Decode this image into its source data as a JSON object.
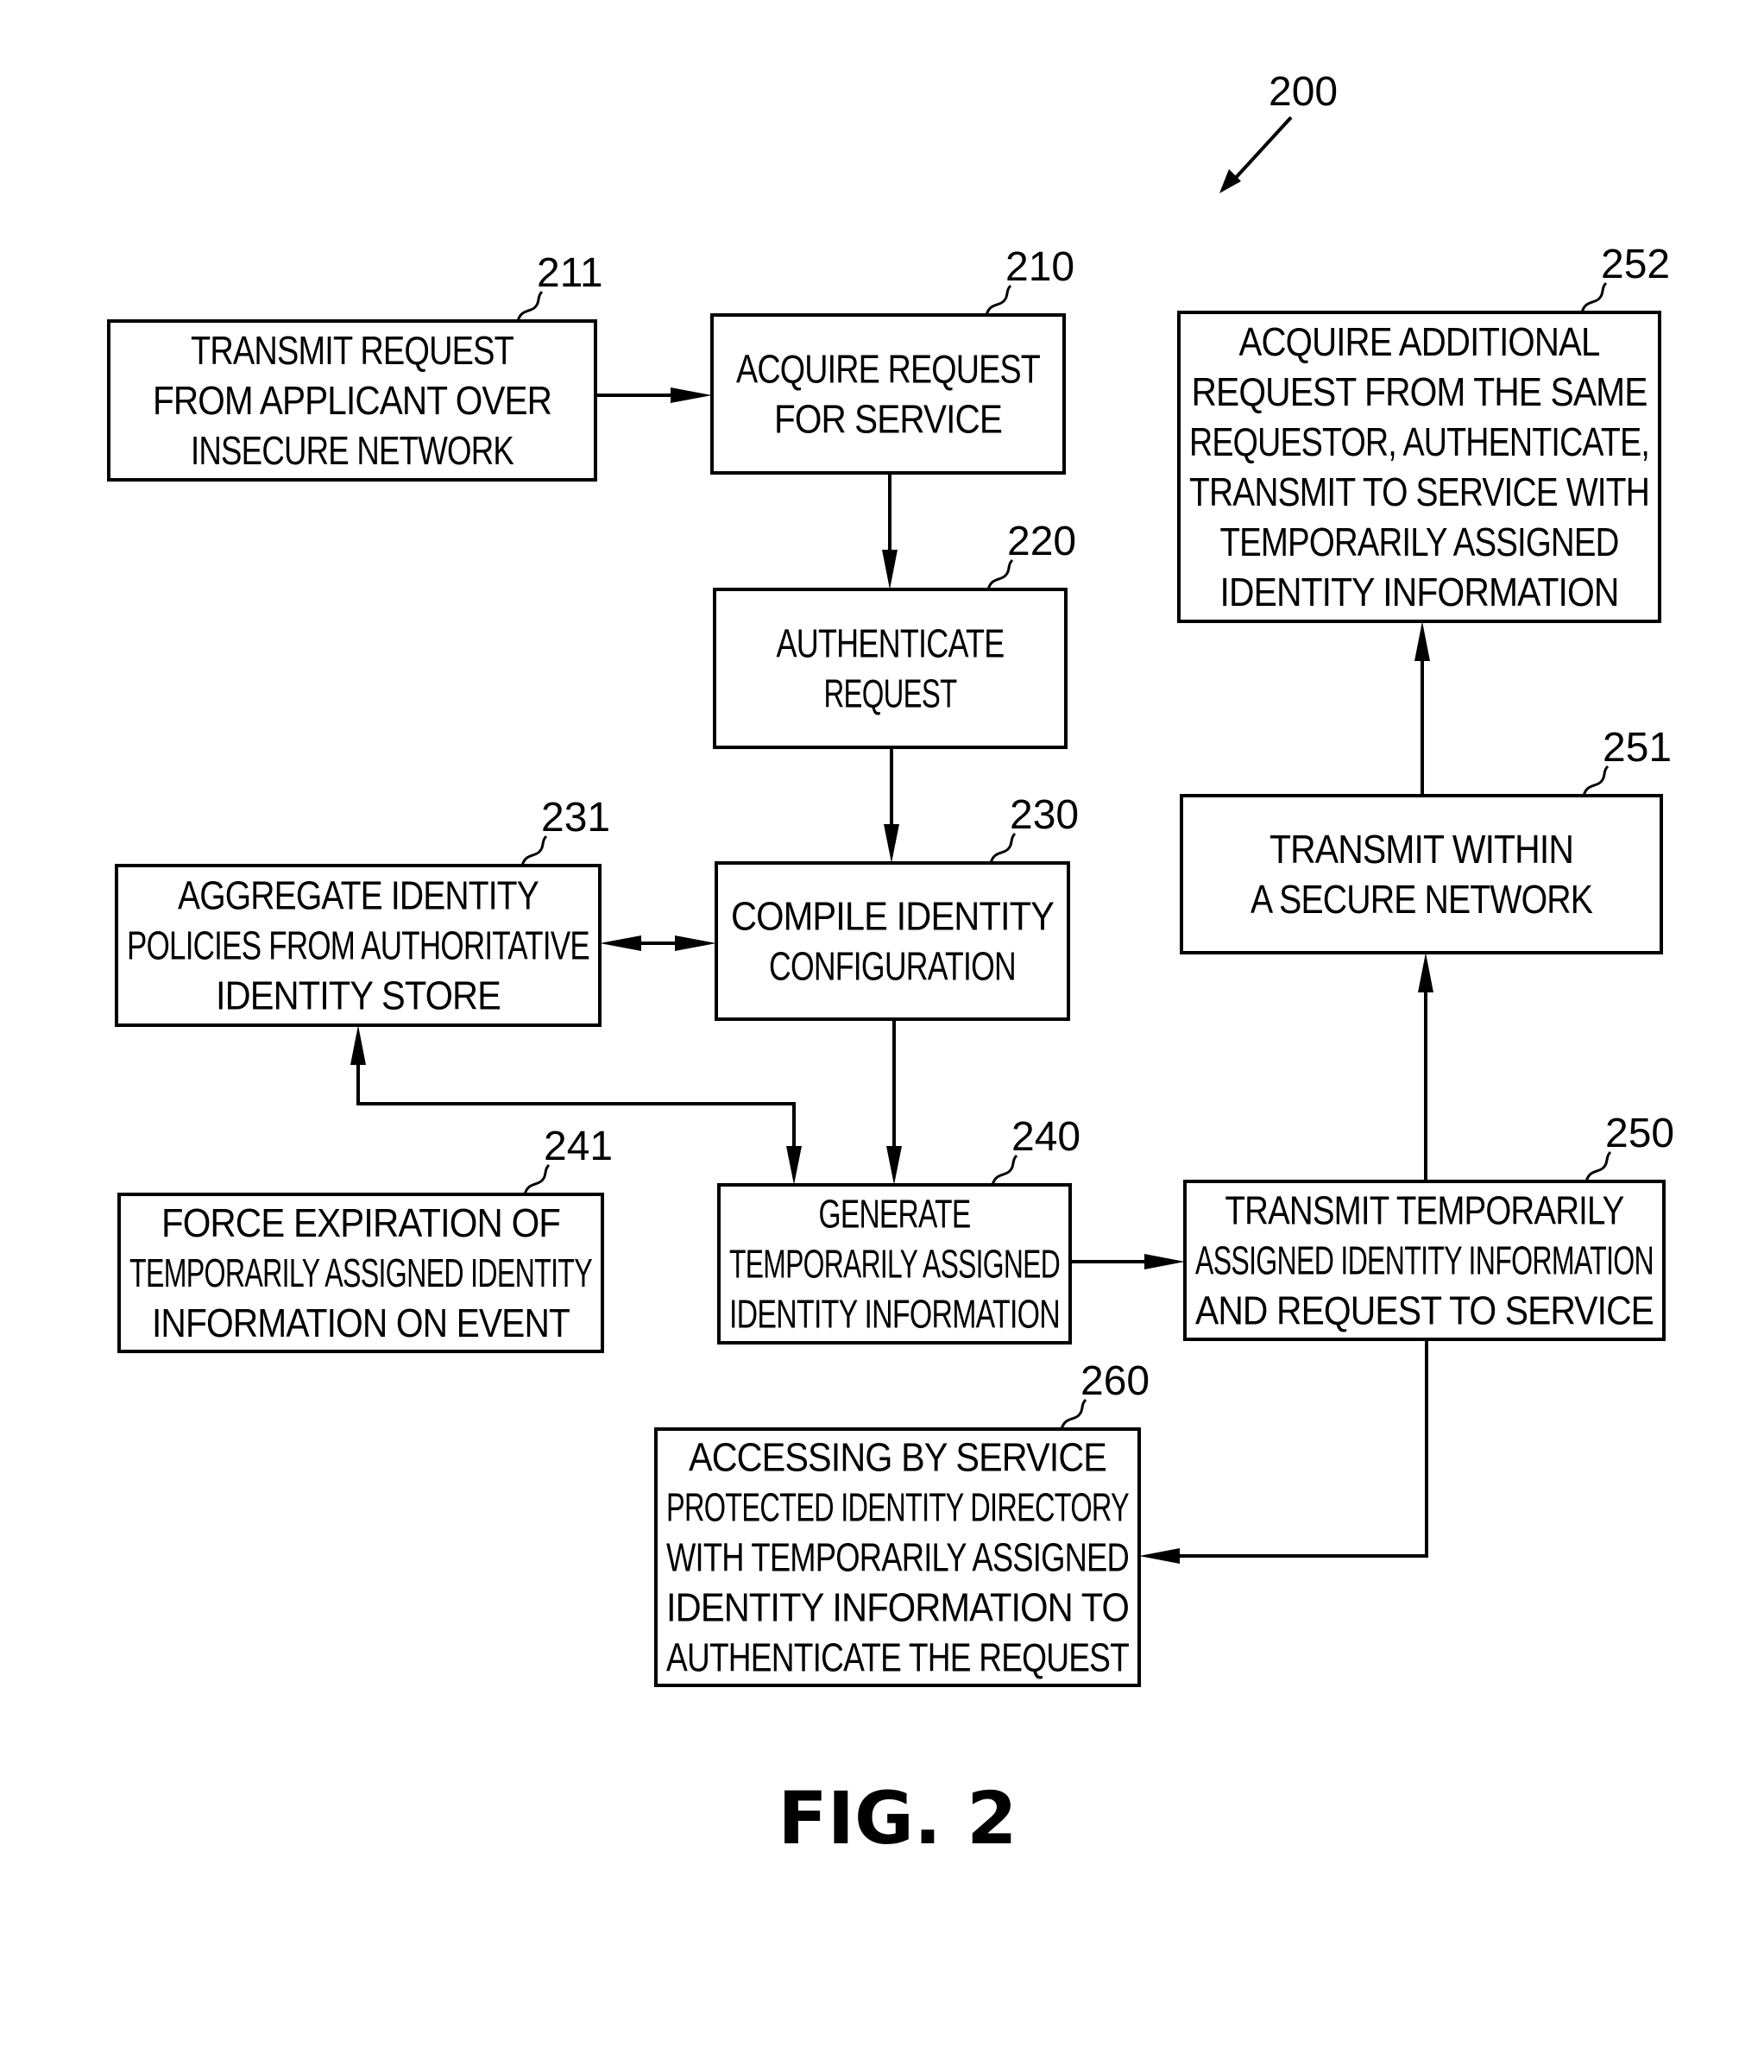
{
  "figure": {
    "label": "FIG. 2",
    "ref_number": "200"
  },
  "nodes": [
    {
      "id": "211",
      "ref": "211",
      "lines": [
        "TRANSMIT  REQUEST",
        "FROM  APPLICANT  OVER",
        "INSECURE  NETWORK"
      ]
    },
    {
      "id": "210",
      "ref": "210",
      "lines": [
        "ACQUIRE  REQUEST",
        "FOR  SERVICE"
      ]
    },
    {
      "id": "220",
      "ref": "220",
      "lines": [
        "AUTHENTICATE",
        "REQUEST"
      ]
    },
    {
      "id": "230",
      "ref": "230",
      "lines": [
        "COMPILE  IDENTITY",
        "CONFIGURATION"
      ]
    },
    {
      "id": "231",
      "ref": "231",
      "lines": [
        "AGGREGATE  IDENTITY",
        "POLICIES  FROM  AUTHORITATIVE",
        "IDENTITY  STORE"
      ]
    },
    {
      "id": "240",
      "ref": "240",
      "lines": [
        "GENERATE",
        "TEMPORARILY  ASSIGNED",
        "IDENTITY  INFORMATION"
      ]
    },
    {
      "id": "241",
      "ref": "241",
      "lines": [
        "FORCE  EXPIRATION  OF",
        "TEMPORARILY  ASSIGNED  IDENTITY",
        "INFORMATION  ON  EVENT"
      ]
    },
    {
      "id": "250",
      "ref": "250",
      "lines": [
        "TRANSMIT  TEMPORARILY",
        "ASSIGNED  IDENTITY  INFORMATION",
        "AND  REQUEST  TO  SERVICE"
      ]
    },
    {
      "id": "251",
      "ref": "251",
      "lines": [
        "TRANSMIT  WITHIN",
        "A  SECURE  NETWORK"
      ]
    },
    {
      "id": "252",
      "ref": "252",
      "lines": [
        "ACQUIRE  ADDITIONAL",
        "REQUEST  FROM  THE  SAME",
        "REQUESTOR,  AUTHENTICATE,",
        "TRANSMIT  TO  SERVICE  WITH",
        "TEMPORARILY  ASSIGNED",
        "IDENTITY  INFORMATION"
      ]
    },
    {
      "id": "260",
      "ref": "260",
      "lines": [
        "ACCESSING  BY  SERVICE",
        "PROTECTED  IDENTITY  DIRECTORY",
        "WITH  TEMPORARILY  ASSIGNED",
        "IDENTITY  INFORMATION  TO",
        "AUTHENTICATE  THE  REQUEST"
      ]
    }
  ],
  "edges": [
    {
      "from": "211",
      "to": "210",
      "direction": "forward"
    },
    {
      "from": "210",
      "to": "220",
      "direction": "forward"
    },
    {
      "from": "220",
      "to": "230",
      "direction": "forward"
    },
    {
      "from": "230",
      "to": "231",
      "direction": "bidirectional"
    },
    {
      "from": "230",
      "to": "240",
      "direction": "forward"
    },
    {
      "from": "240",
      "to": "231",
      "direction": "bidirectional"
    },
    {
      "from": "240",
      "to": "250",
      "direction": "forward"
    },
    {
      "from": "250",
      "to": "251",
      "direction": "forward"
    },
    {
      "from": "251",
      "to": "252",
      "direction": "forward"
    },
    {
      "from": "250",
      "to": "260",
      "direction": "forward"
    }
  ]
}
